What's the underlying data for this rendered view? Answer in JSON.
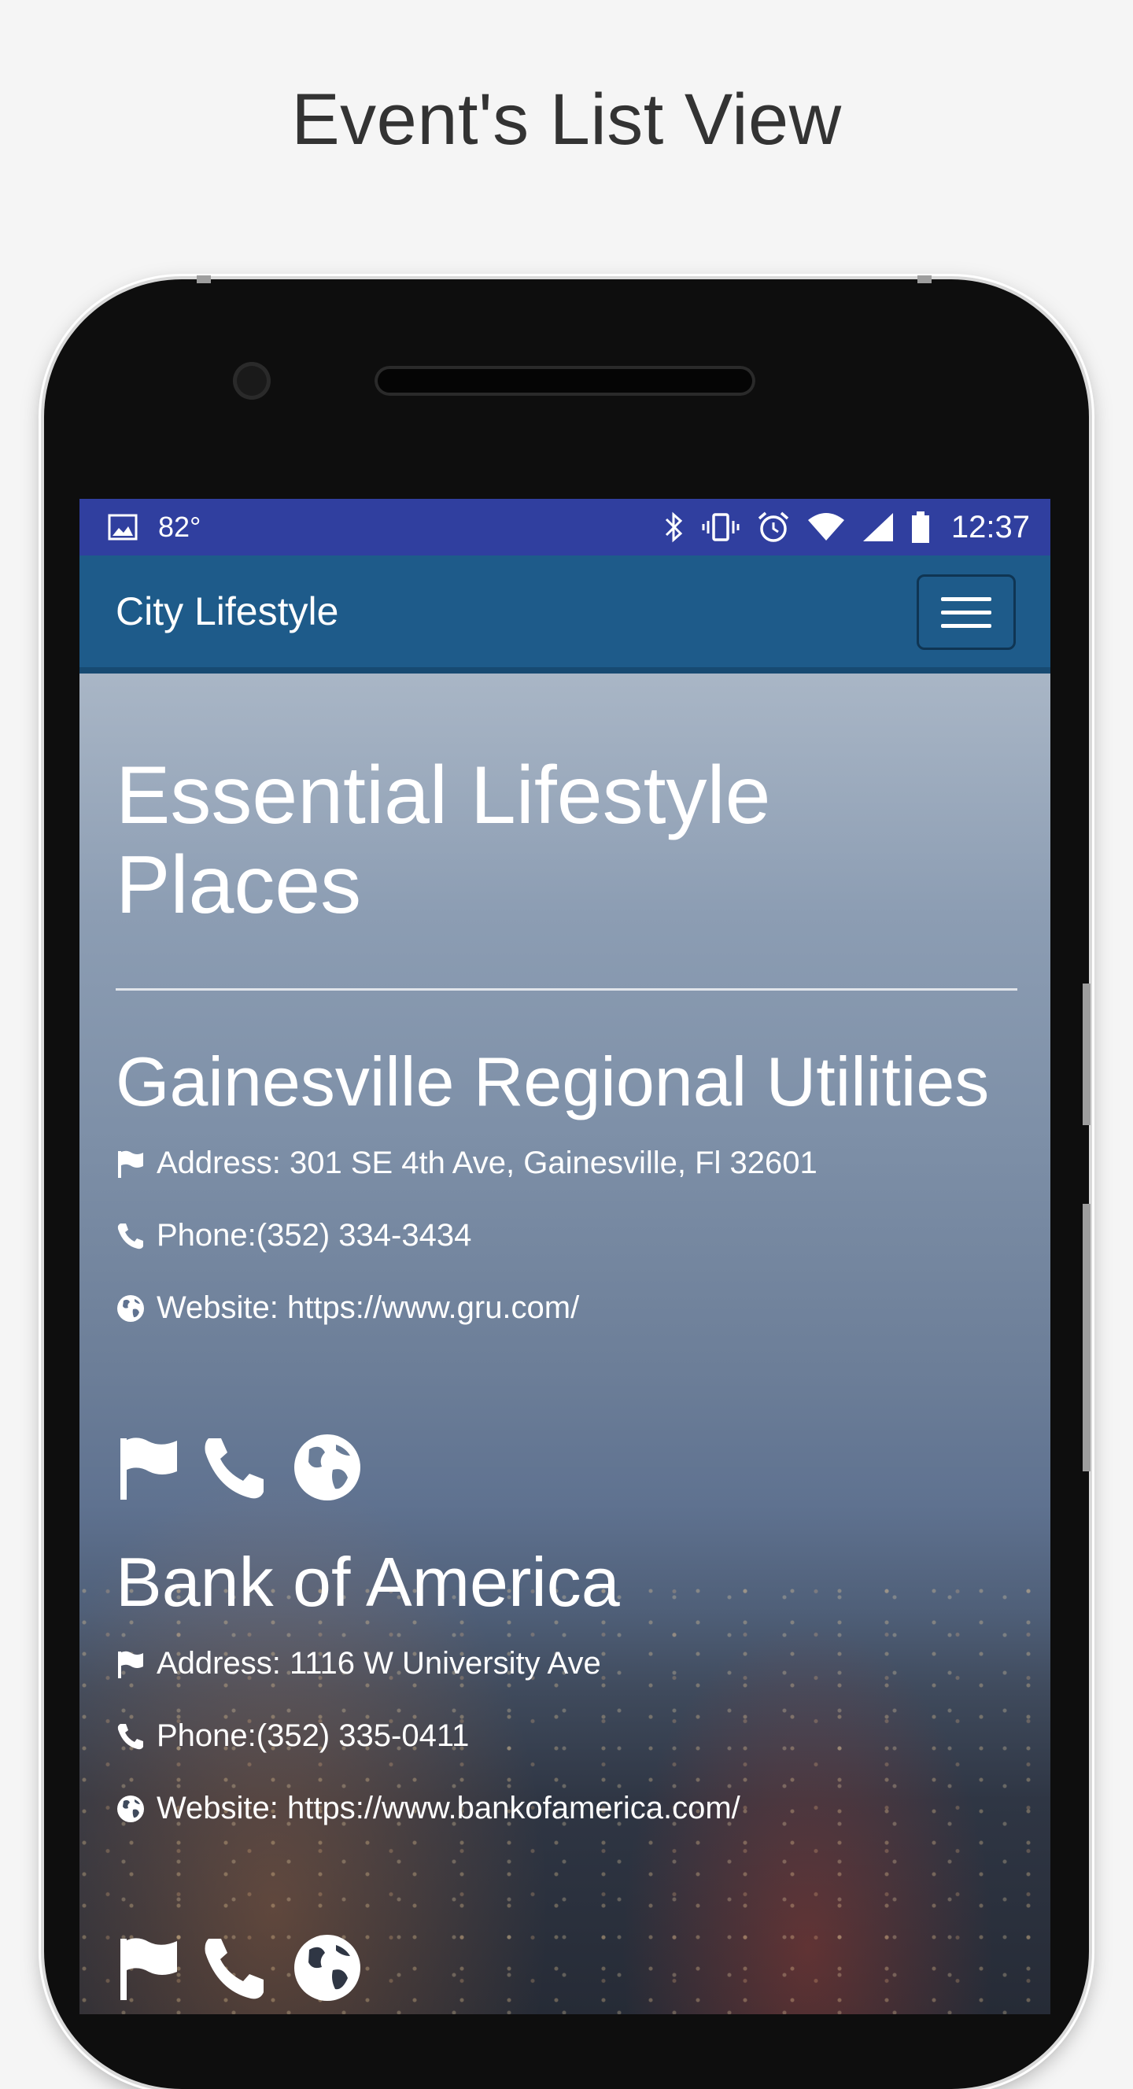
{
  "page_caption": "Event's List View",
  "status_bar": {
    "temperature": "82°",
    "time": "12:37"
  },
  "navbar": {
    "brand": "City Lifestyle"
  },
  "hero": {
    "title_line1": "Essential Lifestyle",
    "title_line2": "Places"
  },
  "places": [
    {
      "name": "Gainesville Regional Utilities",
      "address": "Address: 301 SE 4th Ave, Gainesville, Fl 32601",
      "phone": "Phone:(352) 334-3434",
      "website": "Website: https://www.gru.com/"
    },
    {
      "name": "Bank of America",
      "address": "Address: 1116 W University Ave",
      "phone": "Phone:(352) 335-0411",
      "website": "Website: https://www.bankofamerica.com/"
    }
  ],
  "colors": {
    "status_bar": "#303f9f",
    "navbar": "#1e5b8a",
    "text": "#ffffff"
  },
  "icons": {
    "address": "flag-icon",
    "phone": "phone-icon",
    "website": "globe-icon"
  }
}
